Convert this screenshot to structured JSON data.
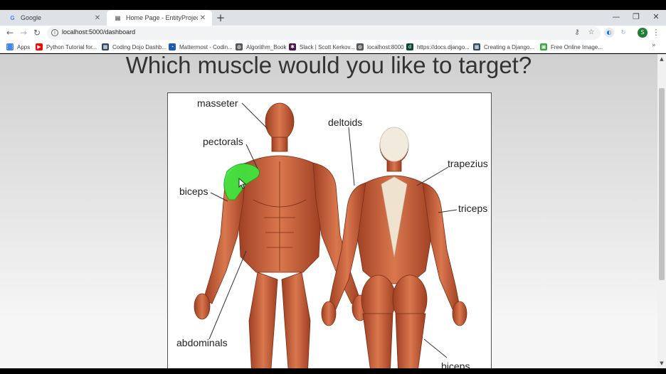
{
  "tabs": [
    {
      "favicon": "G",
      "title": "Google"
    },
    {
      "favicon": "▤",
      "title": "Home Page - EntityProject"
    }
  ],
  "window_controls": {
    "minimize": "—",
    "restore": "❐",
    "close": "✕"
  },
  "toolbar": {
    "back": "←",
    "forward": "→",
    "reload": "↻",
    "url": "localhost:5000/dashboard"
  },
  "profile": {
    "initial": "S"
  },
  "bookmarks": [
    {
      "label": "Apps",
      "icon": "apps-grid-icon",
      "color": "#4285f4"
    },
    {
      "label": "Python Tutorial for...",
      "icon": "youtube-icon",
      "color": "#ff0000"
    },
    {
      "label": "Coding Dojo Dashb...",
      "icon": "dojo-icon",
      "color": "#2c4a66"
    },
    {
      "label": "Mattermost - Codin...",
      "icon": "mattermost-icon",
      "color": "#1e5bb8"
    },
    {
      "label": "Algorithm_Book",
      "icon": "globe-icon",
      "color": "#555555"
    },
    {
      "label": "Slack | Scott Kerkov...",
      "icon": "slack-icon",
      "color": "#4a154b"
    },
    {
      "label": "localhost:8000",
      "icon": "globe-icon",
      "color": "#555555"
    },
    {
      "label": "https://docs.django...",
      "icon": "django-icon",
      "color": "#0c4b33"
    },
    {
      "label": "Creating a Django...",
      "icon": "dojo-icon",
      "color": "#2c4a66"
    },
    {
      "label": "Free Online Image...",
      "icon": "image-icon",
      "color": "#3aa745"
    }
  ],
  "bookmarks_more": "»",
  "page": {
    "heading": "Which muscle would you like to target?",
    "labels": {
      "masseter": "masseter",
      "pectorals": "pectorals",
      "biceps": "biceps",
      "deltoids": "deltoids",
      "trapezius": "trapezius",
      "triceps": "triceps",
      "abdominals": "abdominals",
      "biceps_bottom": "biceps"
    },
    "highlight_color": "#3ee83e",
    "muscle_color": "#c8623c"
  },
  "scrollbar": {
    "up": "▲",
    "down": "▼"
  }
}
